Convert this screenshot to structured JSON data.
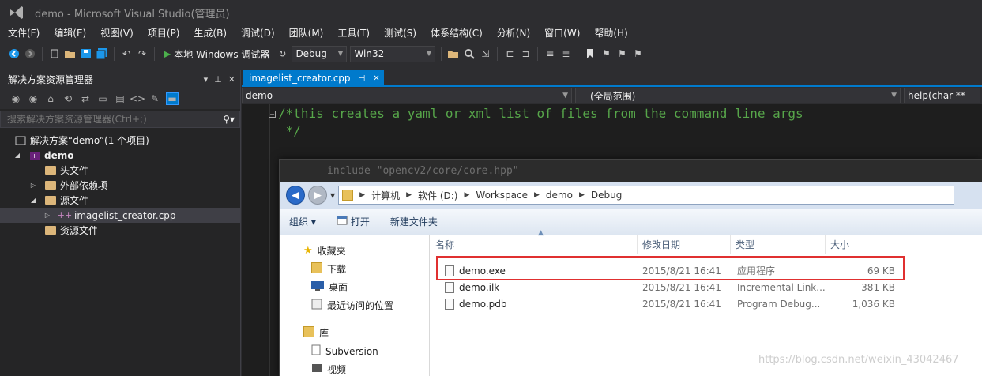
{
  "window": {
    "title": "demo - Microsoft Visual Studio(管理员)"
  },
  "menu": [
    "文件(F)",
    "编辑(E)",
    "视图(V)",
    "项目(P)",
    "生成(B)",
    "调试(D)",
    "团队(M)",
    "工具(T)",
    "测试(S)",
    "体系结构(C)",
    "分析(N)",
    "窗口(W)",
    "帮助(H)"
  ],
  "toolbar": {
    "run_label": "本地 Windows 调试器",
    "config": "Debug",
    "platform": "Win32"
  },
  "solution_explorer": {
    "title": "解决方案资源管理器",
    "search_placeholder": "搜索解决方案资源管理器(Ctrl+;)",
    "tree": [
      {
        "label": "解决方案“demo”(1 个项目)"
      },
      {
        "label": "demo"
      },
      {
        "label": "头文件"
      },
      {
        "label": "外部依赖项"
      },
      {
        "label": "源文件"
      },
      {
        "label": "imagelist_creator.cpp"
      },
      {
        "label": "资源文件"
      }
    ]
  },
  "editor": {
    "tab": "imagelist_creator.cpp",
    "nav_left": "demo",
    "nav_mid": "(全局范围)",
    "nav_right": "help(char **",
    "lines": [
      "/*this creates a yaml or xml list of files from the command line args",
      " */"
    ],
    "obscured_line": "include \"opencv2/core/core.hpp\""
  },
  "explorer": {
    "breadcrumb": [
      "计算机",
      "软件 (D:)",
      "Workspace",
      "demo",
      "Debug"
    ],
    "commands": {
      "organize": "组织 ▾",
      "open": "打开",
      "new_folder": "新建文件夹"
    },
    "nav": {
      "favorites": "收藏夹",
      "downloads": "下载",
      "desktop": "桌面",
      "recent": "最近访问的位置",
      "libraries": "库",
      "subversion": "Subversion",
      "videos": "视频"
    },
    "columns": {
      "name": "名称",
      "date": "修改日期",
      "type": "类型",
      "size": "大小"
    },
    "files": [
      {
        "name": "demo.exe",
        "date": "2015/8/21 16:41",
        "type": "应用程序",
        "size": "69 KB"
      },
      {
        "name": "demo.ilk",
        "date": "2015/8/21 16:41",
        "type": "Incremental Link...",
        "size": "381 KB"
      },
      {
        "name": "demo.pdb",
        "date": "2015/8/21 16:41",
        "type": "Program Debug...",
        "size": "1,036 KB"
      }
    ]
  },
  "watermark": "https://blog.csdn.net/weixin_43042467",
  "colors": {
    "accent": "#007acc",
    "highlight": "#e03030",
    "comment": "#57a64a"
  }
}
